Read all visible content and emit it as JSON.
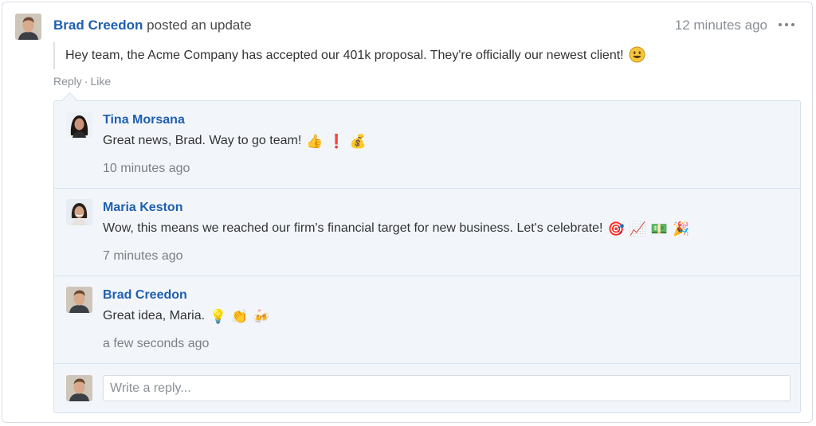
{
  "post": {
    "author": "Brad Creedon",
    "verb": "posted an update",
    "time": "12 minutes ago",
    "body": "Hey team, the Acme Company has accepted our 401k proposal. They're officially our newest client!",
    "body_emoji": "smile-emoji",
    "actions": {
      "reply": "Reply",
      "separator": "·",
      "like": "Like"
    }
  },
  "comments": [
    {
      "author": "Tina Morsana",
      "text": "Great news, Brad. Way to go team!",
      "emojis": [
        "👍",
        "❗",
        "💰"
      ],
      "time": "10 minutes ago"
    },
    {
      "author": "Maria Keston",
      "text": "Wow, this means we reached our firm's financial target for new business. Let's celebrate!",
      "emojis": [
        "🎯",
        "📈",
        "💵",
        "🎉"
      ],
      "time": "7 minutes ago"
    },
    {
      "author": "Brad Creedon",
      "text": "Great idea, Maria.",
      "emojis": [
        "💡",
        "👏",
        "🍻"
      ],
      "time": "a few seconds ago"
    }
  ],
  "reply": {
    "placeholder": "Write a reply..."
  },
  "colors": {
    "link": "#1f5fb0",
    "muted": "#8a8f96",
    "comment_bg": "#f2f6fb",
    "border": "#d6e2ef"
  }
}
